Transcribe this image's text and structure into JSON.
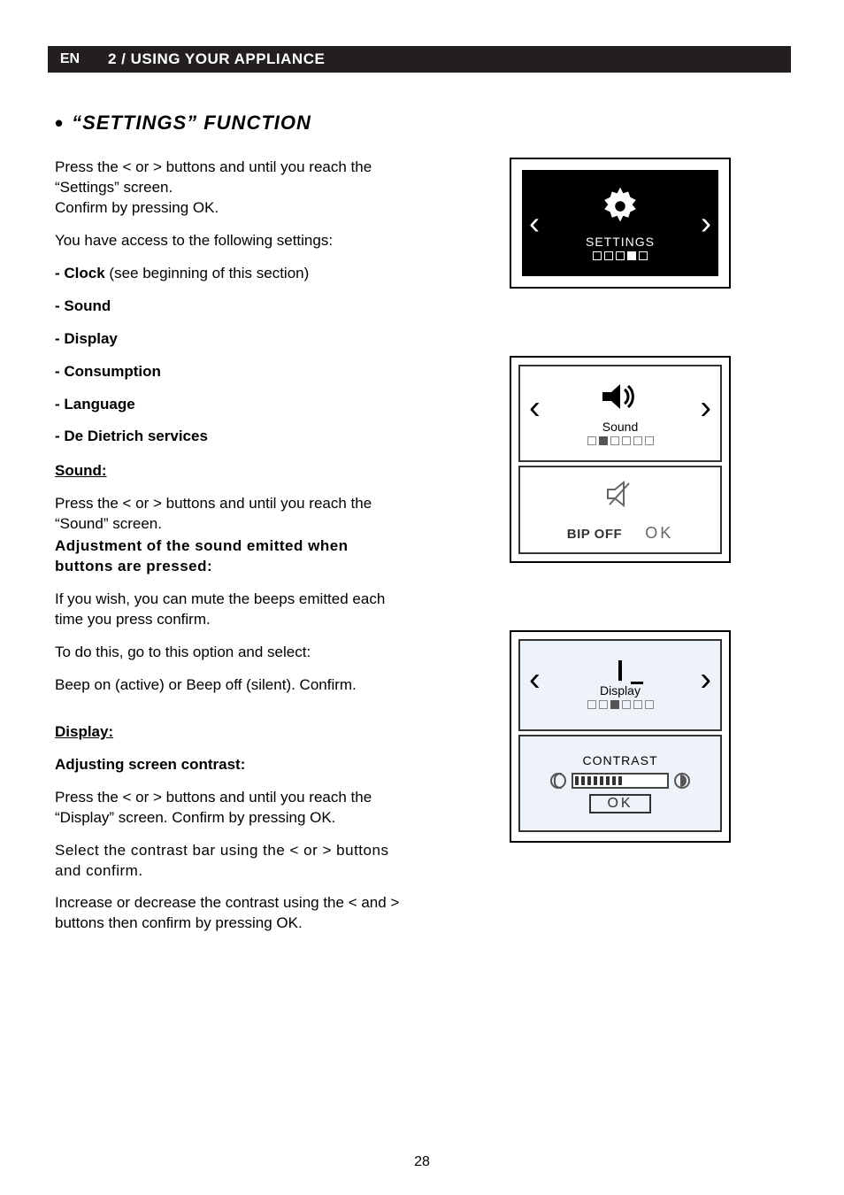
{
  "header": {
    "badge": "EN",
    "title": "2 / USING YOUR APPLIANCE"
  },
  "section": {
    "bullet": "•",
    "title": "“SETTINGS” FUNCTION"
  },
  "intro": {
    "p1": "Press the < or > buttons and until you reach the “Settings” screen.",
    "p2": "Confirm by pressing OK.",
    "p3": "You have access to the following settings:"
  },
  "list": {
    "clock_prefix": "- Clock",
    "clock_note": " (see beginning of this section)",
    "sound": "- Sound",
    "display": "- Display",
    "consumption": "- Consumption",
    "language": "- Language",
    "dedietrich": "- De Dietrich services"
  },
  "sound_section": {
    "heading": "Sound:",
    "p1": "Press the < or > buttons and until you reach the “Sound” screen.",
    "subhead": "Adjustment of the sound emitted when buttons are pressed:",
    "p2": "If you wish, you can mute the beeps emitted each time you press confirm.",
    "p3": "To do this, go to this option and select:",
    "p4": "Beep on (active) or Beep off (silent). Confirm."
  },
  "display_section": {
    "heading": "Display:",
    "subhead": "Adjusting screen contrast:",
    "p1": "Press the < or > buttons and until you reach the “Display” screen. Confirm by pressing OK.",
    "p2": "Select the contrast bar using the < or > buttons and confirm.",
    "p3": "Increase or decrease the contrast using the < and > buttons then confirm by pressing OK."
  },
  "screens": {
    "settings_label": "SETTINGS",
    "sound_label": "Sound",
    "bip_off": "BIP OFF",
    "ok": "OK",
    "display_label": "Display",
    "contrast": "CONTRAST"
  },
  "page_number": "28"
}
